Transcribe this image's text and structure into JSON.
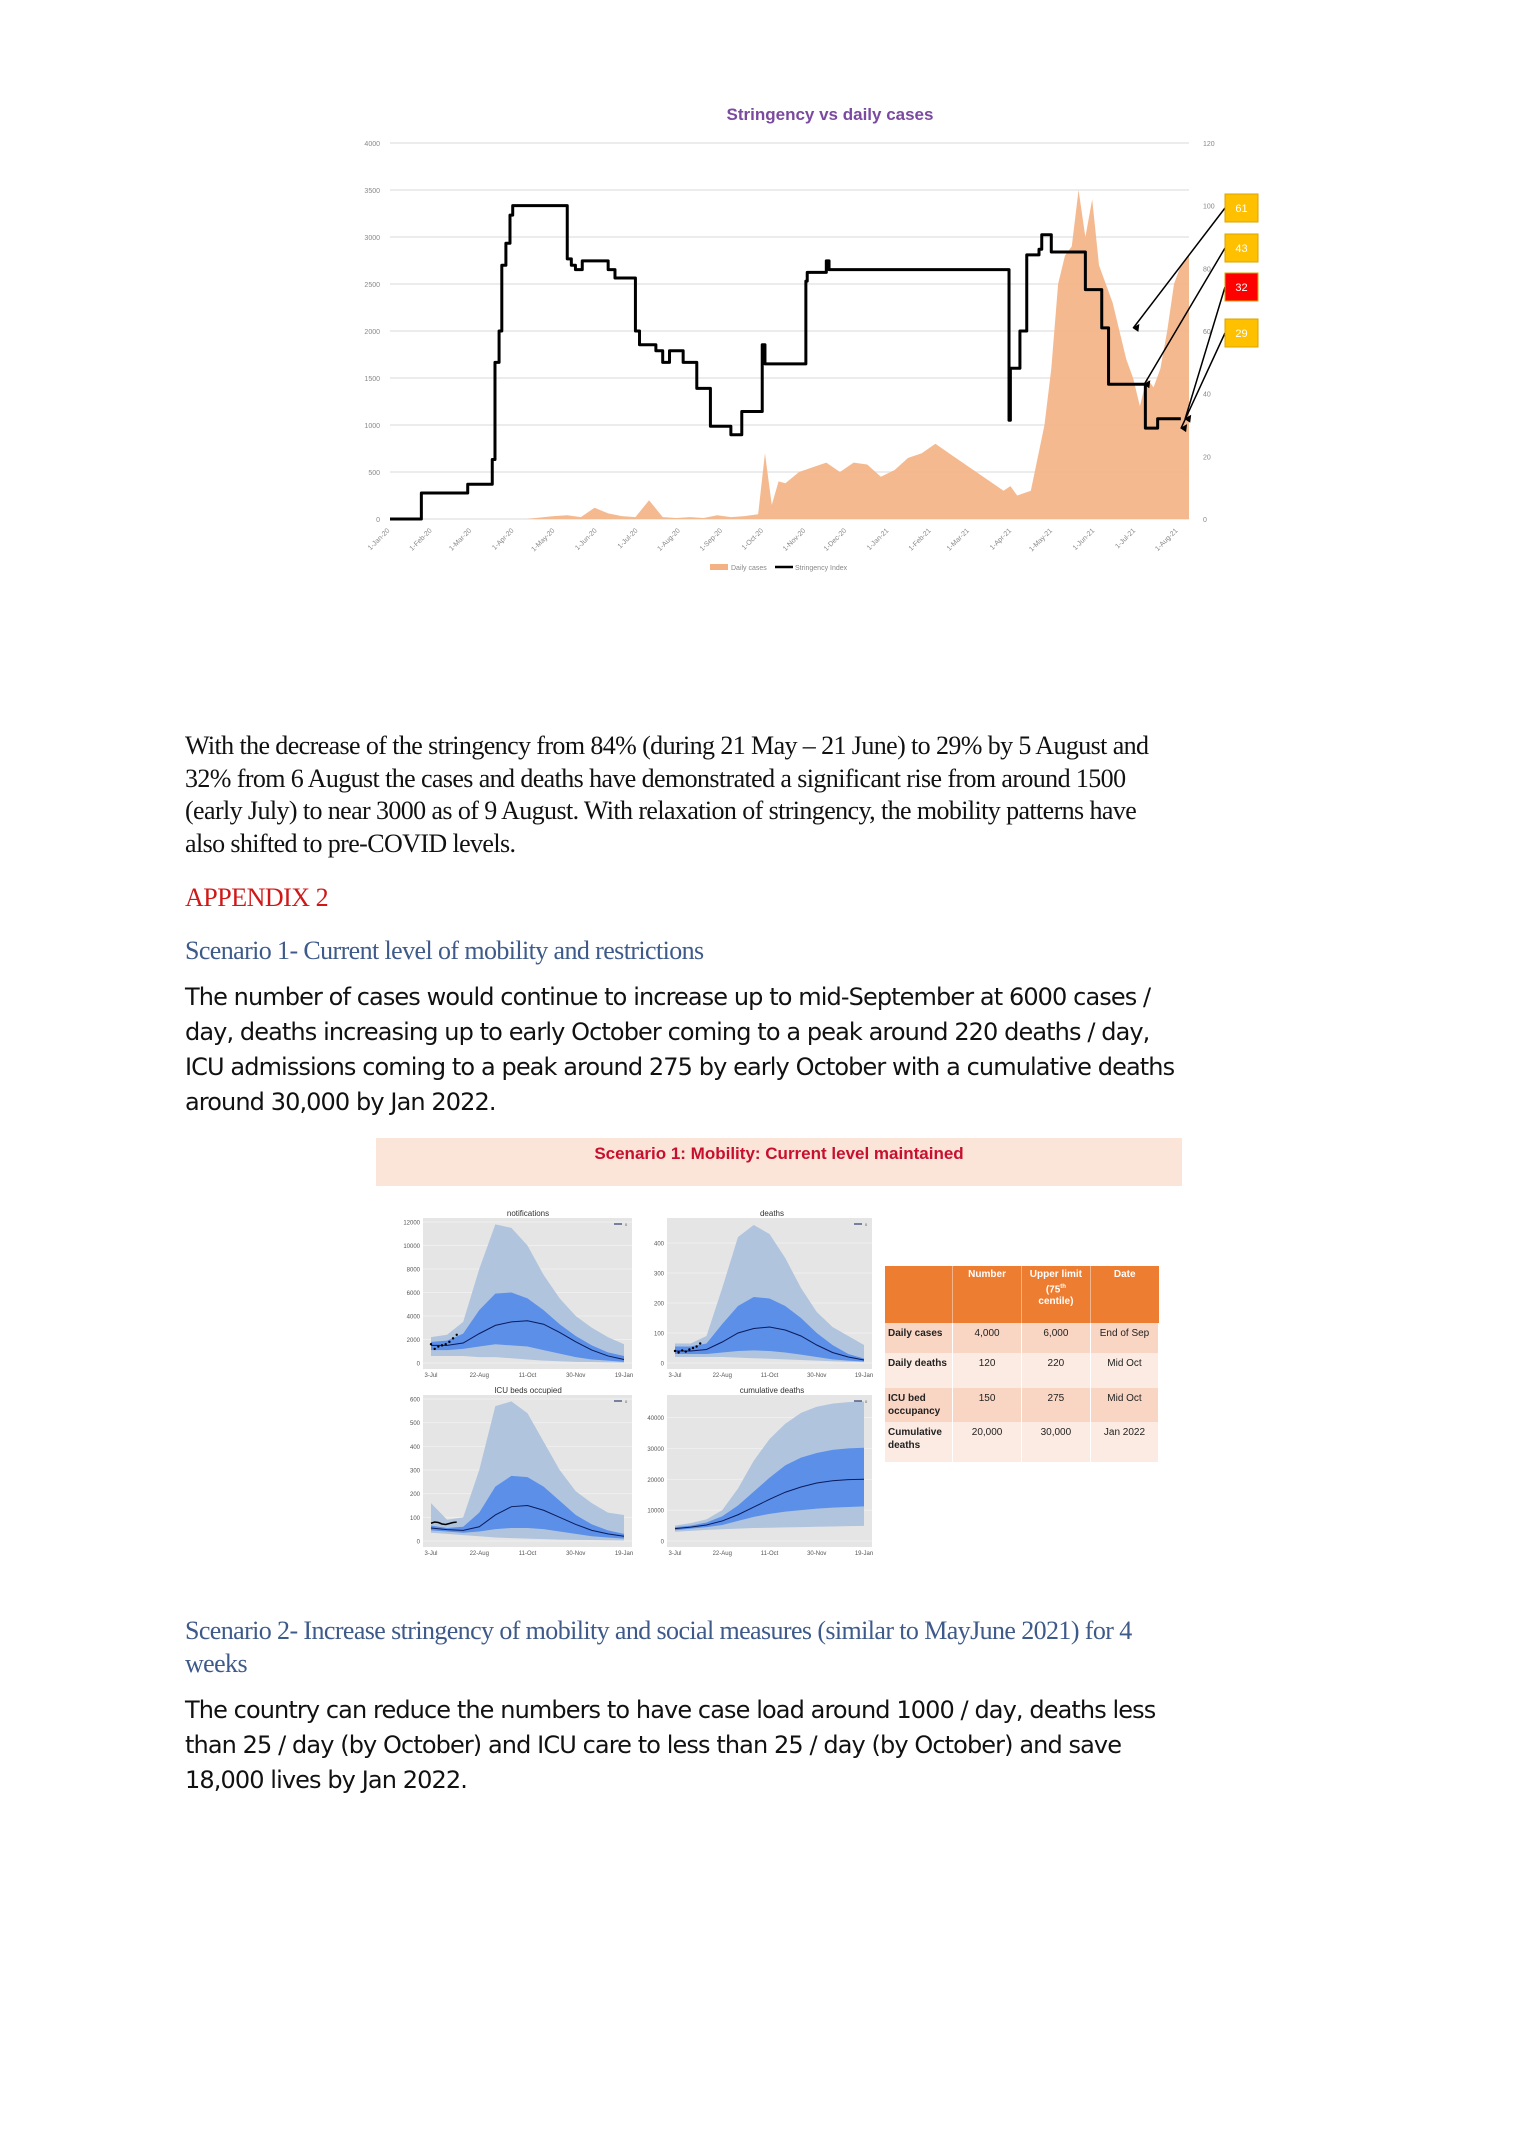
{
  "main_chart": {
    "title": "Stringency vs daily cases",
    "legend": [
      {
        "label": "Daily cases",
        "color": "#f4b183"
      },
      {
        "label": "Stringency Index",
        "color": "#000000"
      }
    ],
    "annotations": [
      {
        "label": "61",
        "color": "#ffc000",
        "points_to": "2021-07-12"
      },
      {
        "label": "43",
        "color": "#ffc000",
        "points_to": "2021-07-20"
      },
      {
        "label": "32",
        "color": "#ff0000",
        "points_to": "2021-08-07"
      },
      {
        "label": "29",
        "color": "#ffc000",
        "points_to": "2021-08-05"
      }
    ]
  },
  "chart_data": [
    {
      "type": "bar+line",
      "title": "Stringency vs daily cases",
      "xlabel": "",
      "ylabel": "",
      "y2label": "",
      "x_tick_labels": [
        "1-Jan-20",
        "1-Feb-20",
        "1-Mar-20",
        "1-Apr-20",
        "1-May-20",
        "1-Jun-20",
        "1-Jul-20",
        "1-Aug-20",
        "1-Sep-20",
        "1-Oct-20",
        "1-Nov-20",
        "1-Dec-20",
        "1-Jan-21",
        "1-Feb-21",
        "1-Mar-21",
        "1-Apr-21",
        "1-May-21",
        "1-Jun-21",
        "1-Jul-21",
        "1-Aug-21"
      ],
      "x_range_days": [
        0,
        586
      ],
      "ylim": [
        0,
        4000
      ],
      "y_ticks": [
        0,
        500,
        1000,
        1500,
        2000,
        2500,
        3000,
        3500,
        4000
      ],
      "y2lim": [
        0,
        120
      ],
      "y2_ticks": [
        0,
        20,
        40,
        60,
        80,
        100,
        120
      ],
      "grid": true,
      "legend_position": "bottom",
      "series": [
        {
          "name": "Daily cases",
          "axis": "left",
          "kind": "area",
          "day": [
            0,
            100,
            120,
            130,
            140,
            150,
            160,
            170,
            180,
            190,
            200,
            210,
            220,
            230,
            240,
            250,
            260,
            270,
            275,
            280,
            285,
            290,
            300,
            310,
            320,
            330,
            340,
            350,
            360,
            370,
            380,
            390,
            400,
            410,
            420,
            430,
            440,
            450,
            455,
            460,
            470,
            480,
            485,
            490,
            495,
            500,
            505,
            510,
            515,
            520,
            525,
            530,
            535,
            540,
            545,
            550,
            555,
            560,
            565,
            570,
            575,
            580,
            586
          ],
          "values": [
            0,
            0,
            30,
            40,
            20,
            120,
            60,
            30,
            20,
            200,
            20,
            10,
            20,
            10,
            40,
            20,
            30,
            50,
            700,
            150,
            400,
            380,
            500,
            550,
            600,
            500,
            600,
            580,
            450,
            520,
            650,
            700,
            800,
            700,
            600,
            500,
            400,
            300,
            350,
            250,
            300,
            1000,
            1600,
            2500,
            2800,
            2900,
            3500,
            3000,
            3400,
            2700,
            2500,
            2300,
            2000,
            1700,
            1500,
            1200,
            1500,
            1400,
            1600,
            2000,
            2500,
            2700,
            2800
          ]
        },
        {
          "name": "Stringency Index",
          "axis": "right",
          "kind": "step",
          "day": [
            0,
            23,
            27,
            57,
            60,
            75,
            77,
            80,
            82,
            85,
            88,
            90,
            92,
            130,
            133,
            136,
            139,
            141,
            155,
            160,
            165,
            168,
            180,
            183,
            190,
            195,
            200,
            205,
            215,
            225,
            235,
            250,
            258,
            262,
            273,
            275,
            305,
            306,
            308,
            320,
            322,
            335,
            344,
            350,
            454,
            455,
            462,
            467,
            476,
            478,
            485,
            491,
            495,
            510,
            522,
            527,
            538,
            554,
            563,
            575,
            580
          ],
          "values": [
            0,
            8.3,
            8.3,
            11.1,
            11.1,
            19,
            50,
            60,
            81,
            88,
            97,
            100,
            100,
            83,
            81,
            79.6,
            79.6,
            82.4,
            82.4,
            79.6,
            76.9,
            76.9,
            60,
            55.6,
            55.6,
            53.7,
            50,
            53.7,
            50,
            41.7,
            29.6,
            26.9,
            34.3,
            34.3,
            55.6,
            49.5,
            75.9,
            78.7,
            78.7,
            82.4,
            79.6,
            79.6,
            79.6,
            79.6,
            31.5,
            48.1,
            60,
            84.3,
            86.1,
            90.7,
            85.2,
            85.2,
            85.2,
            73.2,
            61,
            43,
            43,
            29,
            32,
            32,
            32
          ]
        }
      ]
    },
    {
      "type": "area",
      "title": "notifications",
      "x_tick_labels": [
        "3-Jul",
        "22-Aug",
        "11-Oct",
        "30-Nov",
        "19-Jan"
      ],
      "ylim": [
        0,
        12000
      ],
      "y_ticks": [
        0,
        2000,
        4000,
        6000,
        8000,
        10000,
        12000
      ],
      "legend": "0",
      "series": [
        {
          "name": "median",
          "values": [
            1500,
            1500,
            1700,
            2500,
            3200,
            3500,
            3600,
            3300,
            2600,
            1800,
            1100,
            600,
            300
          ]
        },
        {
          "name": "25-75 band upper",
          "values": [
            1800,
            1900,
            2500,
            4500,
            5900,
            6000,
            5500,
            4500,
            3300,
            2300,
            1500,
            900,
            600
          ]
        },
        {
          "name": "25-75 band lower",
          "values": [
            1100,
            1100,
            1200,
            1400,
            1600,
            1500,
            1400,
            1100,
            800,
            500,
            300,
            200,
            100
          ]
        },
        {
          "name": "outer band upper",
          "values": [
            2200,
            2400,
            3500,
            8000,
            11800,
            11500,
            10000,
            7500,
            5500,
            4000,
            3000,
            2200,
            1600
          ]
        },
        {
          "name": "outer band lower",
          "values": [
            600,
            600,
            600,
            500,
            500,
            400,
            300,
            200,
            150,
            100,
            80,
            50,
            30
          ]
        },
        {
          "name": "observed",
          "kind": "scatter",
          "values": [
            1600,
            1200,
            1400,
            1500,
            1600,
            1800,
            2100,
            2400
          ]
        }
      ]
    },
    {
      "type": "area",
      "title": "deaths",
      "x_tick_labels": [
        "3-Jul",
        "22-Aug",
        "11-Oct",
        "30-Nov",
        "19-Jan"
      ],
      "ylim": [
        0,
        470
      ],
      "y_ticks": [
        0,
        100,
        200,
        300,
        400
      ],
      "legend": "0",
      "series": [
        {
          "name": "median",
          "values": [
            40,
            40,
            45,
            70,
            100,
            115,
            120,
            110,
            90,
            60,
            35,
            20,
            10
          ]
        },
        {
          "name": "25-75 band upper",
          "values": [
            55,
            55,
            65,
            130,
            190,
            220,
            215,
            190,
            150,
            100,
            60,
            30,
            15
          ]
        },
        {
          "name": "25-75 band lower",
          "values": [
            30,
            30,
            30,
            35,
            40,
            42,
            40,
            35,
            28,
            20,
            12,
            8,
            5
          ]
        },
        {
          "name": "outer band upper",
          "values": [
            65,
            65,
            90,
            250,
            420,
            460,
            430,
            350,
            250,
            170,
            120,
            90,
            60
          ]
        },
        {
          "name": "outer band lower",
          "values": [
            20,
            20,
            20,
            20,
            18,
            16,
            14,
            12,
            10,
            8,
            6,
            4,
            3
          ]
        },
        {
          "name": "observed",
          "kind": "scatter",
          "values": [
            40,
            35,
            42,
            38,
            45,
            50,
            55,
            65
          ]
        }
      ]
    },
    {
      "type": "area",
      "title": "ICU beds occupied",
      "x_tick_labels": [
        "3-Jul",
        "22-Aug",
        "11-Oct",
        "30-Nov",
        "19-Jan"
      ],
      "ylim": [
        0,
        600
      ],
      "y_ticks": [
        0,
        100,
        200,
        300,
        400,
        500,
        600
      ],
      "legend": "0",
      "series": [
        {
          "name": "median",
          "values": [
            55,
            48,
            45,
            60,
            110,
            145,
            150,
            130,
            100,
            70,
            45,
            30,
            20
          ]
        },
        {
          "name": "25-75 band upper",
          "values": [
            65,
            55,
            60,
            120,
            230,
            275,
            270,
            230,
            170,
            110,
            70,
            45,
            30
          ]
        },
        {
          "name": "25-75 band lower",
          "values": [
            45,
            40,
            35,
            40,
            50,
            55,
            55,
            50,
            40,
            30,
            20,
            15,
            10
          ]
        },
        {
          "name": "outer band upper",
          "values": [
            160,
            90,
            100,
            300,
            570,
            590,
            540,
            420,
            300,
            210,
            160,
            120,
            110
          ]
        },
        {
          "name": "outer band lower",
          "values": [
            35,
            30,
            25,
            20,
            15,
            12,
            10,
            8,
            6,
            5,
            4,
            3,
            2
          ]
        },
        {
          "name": "observed",
          "kind": "line",
          "values": [
            75,
            80,
            78,
            72,
            70,
            74,
            78,
            80
          ]
        }
      ]
    },
    {
      "type": "area",
      "title": "cumulative deaths",
      "x_tick_labels": [
        "3-Jul",
        "22-Aug",
        "11-Oct",
        "30-Nov",
        "19-Jan"
      ],
      "ylim": [
        0,
        46000
      ],
      "y_ticks": [
        0,
        10000,
        20000,
        30000,
        40000
      ],
      "legend": "0",
      "series": [
        {
          "name": "median",
          "values": [
            4000,
            4500,
            5200,
            6500,
            8500,
            11000,
            13500,
            15800,
            17500,
            18800,
            19500,
            19900,
            20000
          ]
        },
        {
          "name": "25-75 band upper",
          "values": [
            4500,
            5000,
            6000,
            8000,
            11500,
            16000,
            20500,
            24500,
            27000,
            28500,
            29500,
            30000,
            30200
          ]
        },
        {
          "name": "25-75 band lower",
          "values": [
            3500,
            4000,
            4500,
            5200,
            6500,
            7800,
            8800,
            9500,
            10000,
            10500,
            10800,
            11000,
            11200
          ]
        },
        {
          "name": "outer band upper",
          "values": [
            5000,
            5800,
            7000,
            10000,
            17000,
            26000,
            33000,
            38000,
            41500,
            43500,
            44500,
            45000,
            45200
          ]
        },
        {
          "name": "outer band lower",
          "values": [
            3000,
            3300,
            3600,
            3800,
            4000,
            4200,
            4300,
            4400,
            4500,
            4600,
            4700,
            4800,
            4900
          ]
        }
      ]
    }
  ],
  "paragraph_1": [
    "With the decrease of the stringency from 84% (during 21 May – 21 June) to 29% by 5 August and",
    "32% from 6 August the cases and deaths have demonstrated a significant rise from around 1500",
    "(early July) to near 3000 as of 9 August. With relaxation of stringency, the mobility patterns have",
    "also shifted to pre-COVID levels."
  ],
  "appendix_heading": "APPENDIX 2",
  "scenario_1": {
    "heading": "Scenario 1- Current level of mobility and restrictions",
    "body": [
      "The number of cases would continue to increase up to mid-September at 6000 cases /",
      "day, deaths increasing up to early October coming to a peak around 220 deaths / day,",
      "ICU admissions coming to a peak around 275 by early October with a cumulative deaths",
      "around 30,000 by Jan 2022."
    ],
    "figure_title": "Scenario 1: Mobility: Current level maintained",
    "table": {
      "headers": [
        "",
        "Number",
        "Upper limit (75",
        "th",
        " centile)",
        "Date"
      ],
      "header_cells": [
        "",
        "Number",
        "Upper limit",
        "Date"
      ],
      "header_upper_line2": "(75",
      "header_upper_sup": "th",
      "header_upper_line3": "centile)",
      "rows": [
        {
          "label": "Daily cases",
          "number": "4,000",
          "upper": "6,000",
          "date": "End of Sep"
        },
        {
          "label": "Daily deaths",
          "number": "120",
          "upper": "220",
          "date": "Mid Oct"
        },
        {
          "label": "ICU bed occupancy",
          "number": "150",
          "upper": "275",
          "date": "Mid Oct"
        },
        {
          "label": "Cumulative deaths",
          "number": "20,000",
          "upper": "30,000",
          "date": "Jan 2022"
        }
      ]
    }
  },
  "scenario_2": {
    "heading": [
      "Scenario 2- Increase stringency of mobility and social measures (similar to MayJune 2021) for 4",
      "weeks"
    ],
    "body": [
      "The country can reduce the numbers to have case load around 1000 / day, deaths less",
      "than 25 / day (by October) and ICU care to less than 25 / day (by October) and save",
      "18,000 lives by Jan 2022."
    ]
  }
}
